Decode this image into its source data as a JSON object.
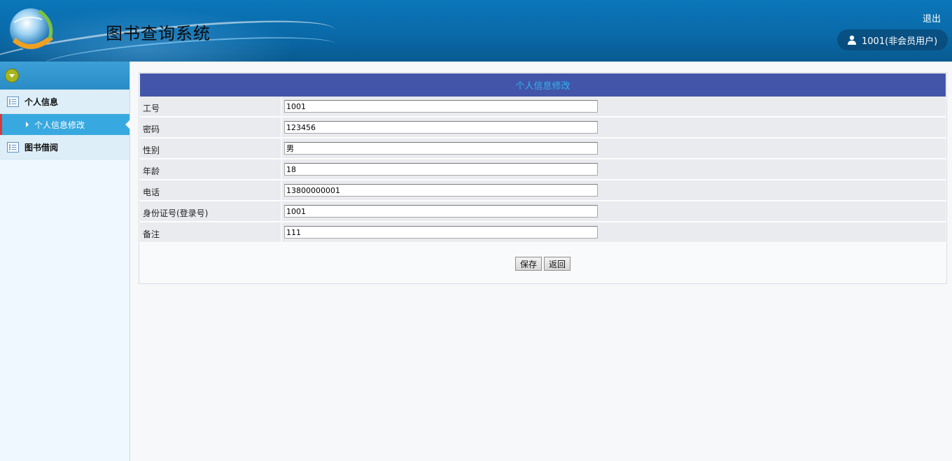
{
  "header": {
    "app_title": "图书查询系统",
    "logout_label": "退出",
    "user_label": "1001(非会员用户)"
  },
  "sidebar": {
    "groups": [
      {
        "label": "个人信息",
        "items": [
          {
            "label": "个人信息修改",
            "active": true
          }
        ]
      },
      {
        "label": "图书借阅",
        "items": []
      }
    ]
  },
  "form": {
    "title": "个人信息修改",
    "fields": [
      {
        "label": "工号",
        "value": "1001"
      },
      {
        "label": "密码",
        "value": "123456"
      },
      {
        "label": "性别",
        "value": "男"
      },
      {
        "label": "年龄",
        "value": "18"
      },
      {
        "label": "电话",
        "value": "13800000001"
      },
      {
        "label": "身份证号(登录号)",
        "value": "1001"
      },
      {
        "label": "备注",
        "value": "111"
      }
    ],
    "save_label": "保存",
    "back_label": "返回"
  },
  "colors": {
    "header_bg": "#0a6aa9",
    "sidebar_active": "#38a9e0",
    "form_title_bg": "#4255a9",
    "form_title_text": "#2fb4f0"
  }
}
